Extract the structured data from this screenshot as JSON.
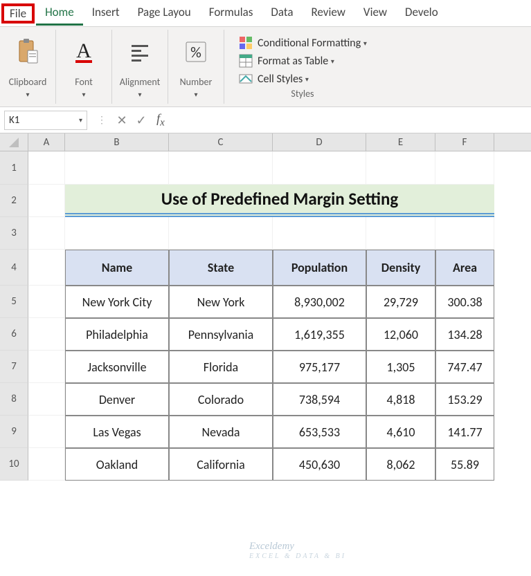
{
  "tabs": {
    "file": "File",
    "home": "Home",
    "insert": "Insert",
    "pageLayout": "Page Layou",
    "formulas": "Formulas",
    "data": "Data",
    "review": "Review",
    "view": "View",
    "developer": "Develo"
  },
  "ribbon": {
    "clipboard": {
      "label": "Clipboard"
    },
    "font": {
      "label": "Font"
    },
    "alignment": {
      "label": "Alignment"
    },
    "number": {
      "label": "Number",
      "percent": "%"
    },
    "styles": {
      "conditional": "Conditional Formatting",
      "formatAsTable": "Format as Table",
      "cellStyles": "Cell Styles",
      "label": "Styles"
    }
  },
  "formulaBar": {
    "nameBox": "K1",
    "formula": ""
  },
  "columns": [
    "A",
    "B",
    "C",
    "D",
    "E",
    "F"
  ],
  "rows": [
    "1",
    "2",
    "3",
    "4",
    "5",
    "6",
    "7",
    "8",
    "9",
    "10"
  ],
  "sheet": {
    "title": "Use of Predefined Margin Setting",
    "headers": [
      "Name",
      "State",
      "Population",
      "Density",
      "Area"
    ],
    "data": [
      [
        "New York City",
        "New York",
        "8,930,002",
        "29,729",
        "300.38"
      ],
      [
        "Philadelphia",
        "Pennsylvania",
        "1,619,355",
        "12,060",
        "134.28"
      ],
      [
        "Jacksonville",
        "Florida",
        "975,177",
        "1,305",
        "747.47"
      ],
      [
        "Denver",
        "Colorado",
        "738,594",
        "4,818",
        "153.29"
      ],
      [
        "Las Vegas",
        "Nevada",
        "653,533",
        "4,610",
        "141.77"
      ],
      [
        "Oakland",
        "California",
        "450,630",
        "8,062",
        "55.89"
      ]
    ]
  },
  "watermark": {
    "main": "Exceldemy",
    "sub": "EXCEL & DATA & BI"
  }
}
